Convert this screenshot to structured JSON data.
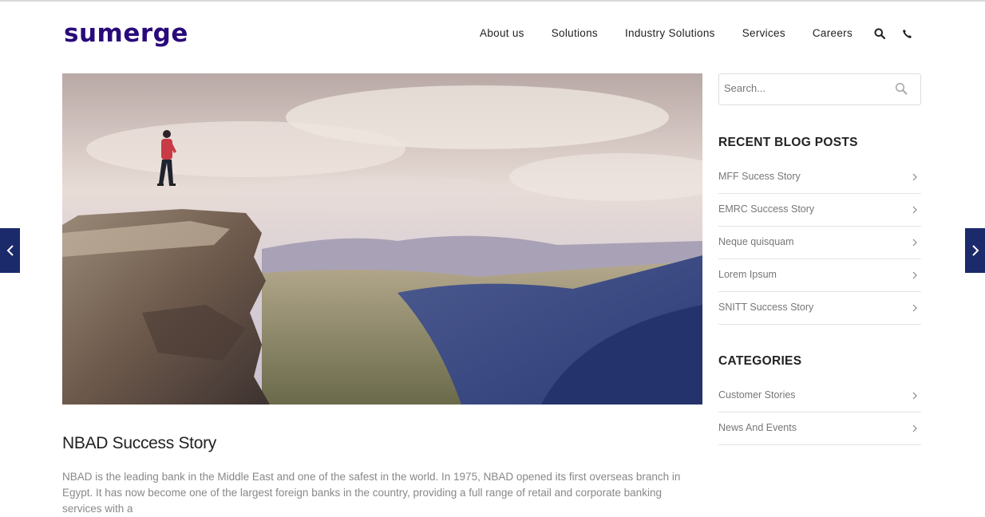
{
  "brand": {
    "logo_text": "sumerge",
    "color": "#2a0a7a"
  },
  "nav": {
    "items": [
      {
        "label": "About us"
      },
      {
        "label": "Solutions"
      },
      {
        "label": "Industry Solutions"
      },
      {
        "label": "Services"
      },
      {
        "label": "Careers"
      }
    ],
    "icons": [
      "search-icon",
      "phone-icon"
    ]
  },
  "post": {
    "title": "NBAD Success Story",
    "text": "NBAD is the leading bank in the Middle East and one of the safest in the world. In 1975, NBAD opened its first overseas branch in Egypt. It has now become one of the largest foreign banks in the country, providing a full range of retail and corporate banking services with a"
  },
  "sidebar": {
    "search": {
      "placeholder": "Search..."
    },
    "recent_title": "RECENT BLOG POSTS",
    "recent_posts": [
      {
        "label": "MFF Sucess Story"
      },
      {
        "label": "EMRC Success Story"
      },
      {
        "label": "Neque quisquam"
      },
      {
        "label": "Lorem Ipsum"
      },
      {
        "label": "SNITT Success Story"
      }
    ],
    "categories_title": "CATEGORIES",
    "categories": [
      {
        "label": "Customer Stories"
      },
      {
        "label": "News And Events"
      }
    ]
  },
  "colors": {
    "arrow_bg": "#1b2a6b",
    "text_muted": "#888888"
  }
}
